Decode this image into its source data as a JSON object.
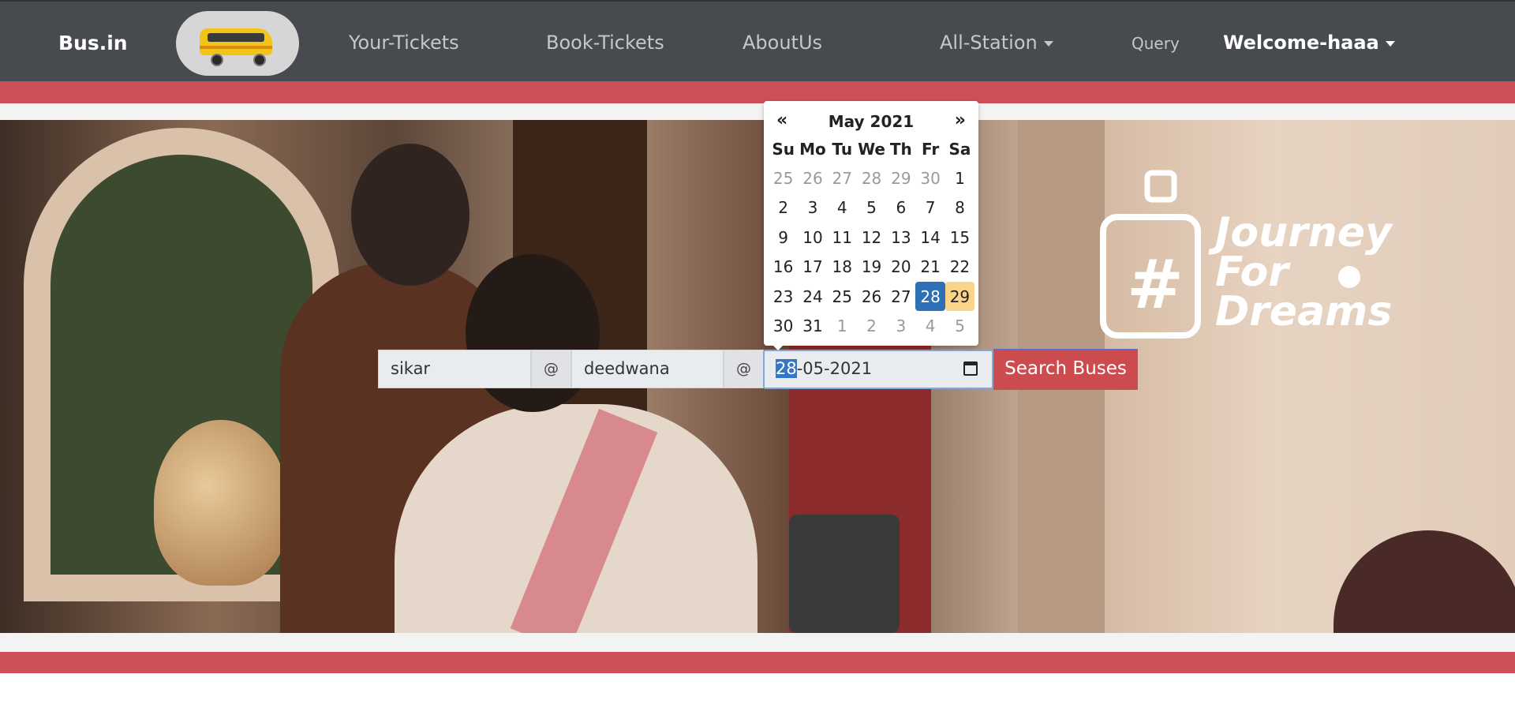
{
  "navbar": {
    "brand": "Bus.in",
    "links": [
      "Your-Tickets",
      "Book-Tickets",
      "AboutUs",
      "All-Station",
      "Query"
    ],
    "user": "Welcome-haaa"
  },
  "hero": {
    "logo_text": [
      "Journey",
      "For",
      "Dreams"
    ],
    "logo_symbol": "#"
  },
  "search": {
    "from": "sikar",
    "separator_1": "@",
    "to": "deedwana",
    "separator_2": "@",
    "date_selected_part": "28",
    "date_rest": "-05-2021",
    "button": "Search Buses"
  },
  "datepicker": {
    "prev": "«",
    "next": "»",
    "month": "May 2021",
    "weekdays": [
      "Su",
      "Mo",
      "Tu",
      "We",
      "Th",
      "Fr",
      "Sa"
    ],
    "days": [
      {
        "n": "25",
        "s": "muted"
      },
      {
        "n": "26",
        "s": "muted"
      },
      {
        "n": "27",
        "s": "muted"
      },
      {
        "n": "28",
        "s": "muted"
      },
      {
        "n": "29",
        "s": "muted"
      },
      {
        "n": "30",
        "s": "muted"
      },
      {
        "n": "1",
        "s": ""
      },
      {
        "n": "2",
        "s": ""
      },
      {
        "n": "3",
        "s": ""
      },
      {
        "n": "4",
        "s": ""
      },
      {
        "n": "5",
        "s": ""
      },
      {
        "n": "6",
        "s": ""
      },
      {
        "n": "7",
        "s": ""
      },
      {
        "n": "8",
        "s": ""
      },
      {
        "n": "9",
        "s": ""
      },
      {
        "n": "10",
        "s": ""
      },
      {
        "n": "11",
        "s": ""
      },
      {
        "n": "12",
        "s": ""
      },
      {
        "n": "13",
        "s": ""
      },
      {
        "n": "14",
        "s": ""
      },
      {
        "n": "15",
        "s": ""
      },
      {
        "n": "16",
        "s": ""
      },
      {
        "n": "17",
        "s": ""
      },
      {
        "n": "18",
        "s": ""
      },
      {
        "n": "19",
        "s": ""
      },
      {
        "n": "20",
        "s": ""
      },
      {
        "n": "21",
        "s": ""
      },
      {
        "n": "22",
        "s": ""
      },
      {
        "n": "23",
        "s": ""
      },
      {
        "n": "24",
        "s": ""
      },
      {
        "n": "25",
        "s": ""
      },
      {
        "n": "26",
        "s": ""
      },
      {
        "n": "27",
        "s": ""
      },
      {
        "n": "28",
        "s": "active"
      },
      {
        "n": "29",
        "s": "today"
      },
      {
        "n": "30",
        "s": ""
      },
      {
        "n": "31",
        "s": ""
      },
      {
        "n": "1",
        "s": "muted"
      },
      {
        "n": "2",
        "s": "muted"
      },
      {
        "n": "3",
        "s": "muted"
      },
      {
        "n": "4",
        "s": "muted"
      },
      {
        "n": "5",
        "s": "muted"
      }
    ]
  },
  "colors": {
    "navbar": "#474b50",
    "band": "#cd4f57",
    "button": "#cc4b4f",
    "active_day": "#2e6fb6",
    "today_day": "#f9d48a"
  }
}
